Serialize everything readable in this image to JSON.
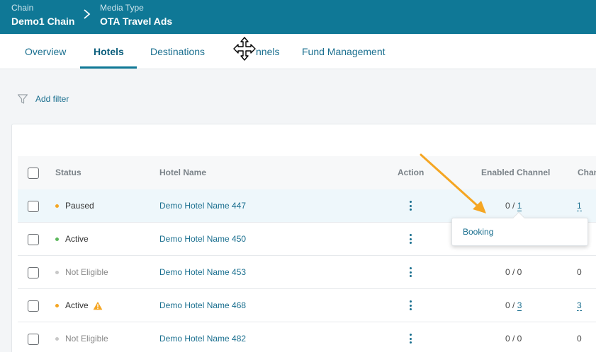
{
  "header": {
    "chain_label": "Chain",
    "chain_value": "Demo1 Chain",
    "media_label": "Media Type",
    "media_value": "OTA Travel Ads"
  },
  "tabs": [
    {
      "label": "Overview",
      "active": false
    },
    {
      "label": "Hotels",
      "active": true
    },
    {
      "label": "Destinations",
      "active": false
    },
    {
      "label": "Channels",
      "active": false
    },
    {
      "label": "Fund Management",
      "active": false
    }
  ],
  "tab_channels_visible": "nnels",
  "filter": {
    "label": "Add filter"
  },
  "table": {
    "headers": {
      "status": "Status",
      "hotel_name": "Hotel Name",
      "action": "Action",
      "enabled_channel": "Enabled Channel",
      "channels_truncated": "Chan"
    },
    "rows": [
      {
        "status": "Paused",
        "status_color": "#f5a623",
        "hotel": "Demo Hotel Name 447",
        "enabled": "0 / ",
        "enabled_link": "1",
        "channels": "1",
        "channels_link": true,
        "warning": false,
        "hover": true
      },
      {
        "status": "Active",
        "status_color": "#5cb85c",
        "hotel": "Demo Hotel Name 450",
        "enabled": "",
        "enabled_link": "",
        "channels": "",
        "channels_link": false,
        "warning": false,
        "hover": false
      },
      {
        "status": "Not Eligible",
        "status_color": "#c8c8c8",
        "hotel": "Demo Hotel Name 453",
        "enabled": "0 / 0",
        "enabled_link": "",
        "channels": "0",
        "channels_link": false,
        "warning": false,
        "hover": false
      },
      {
        "status": "Active",
        "status_color": "#f5a623",
        "hotel": "Demo Hotel Name 468",
        "enabled": "0 / ",
        "enabled_link": "3",
        "channels": "3",
        "channels_link": true,
        "warning": true,
        "hover": false
      },
      {
        "status": "Not Eligible",
        "status_color": "#c8c8c8",
        "hotel": "Demo Hotel Name 482",
        "enabled": "0 / 0",
        "enabled_link": "",
        "channels": "0",
        "channels_link": false,
        "warning": false,
        "hover": false
      }
    ]
  },
  "popover": {
    "item": "Booking"
  },
  "colors": {
    "header_bg": "#0f7896",
    "link": "#1a6f8f",
    "warning": "#f5a623",
    "annotation_arrow": "#f5a623"
  },
  "icons": {
    "breadcrumb_separator": "chevron-right-icon",
    "filter": "funnel-icon",
    "action": "kebab-menu-icon",
    "warning": "warning-triangle-icon",
    "cursor": "move-cursor-icon"
  }
}
